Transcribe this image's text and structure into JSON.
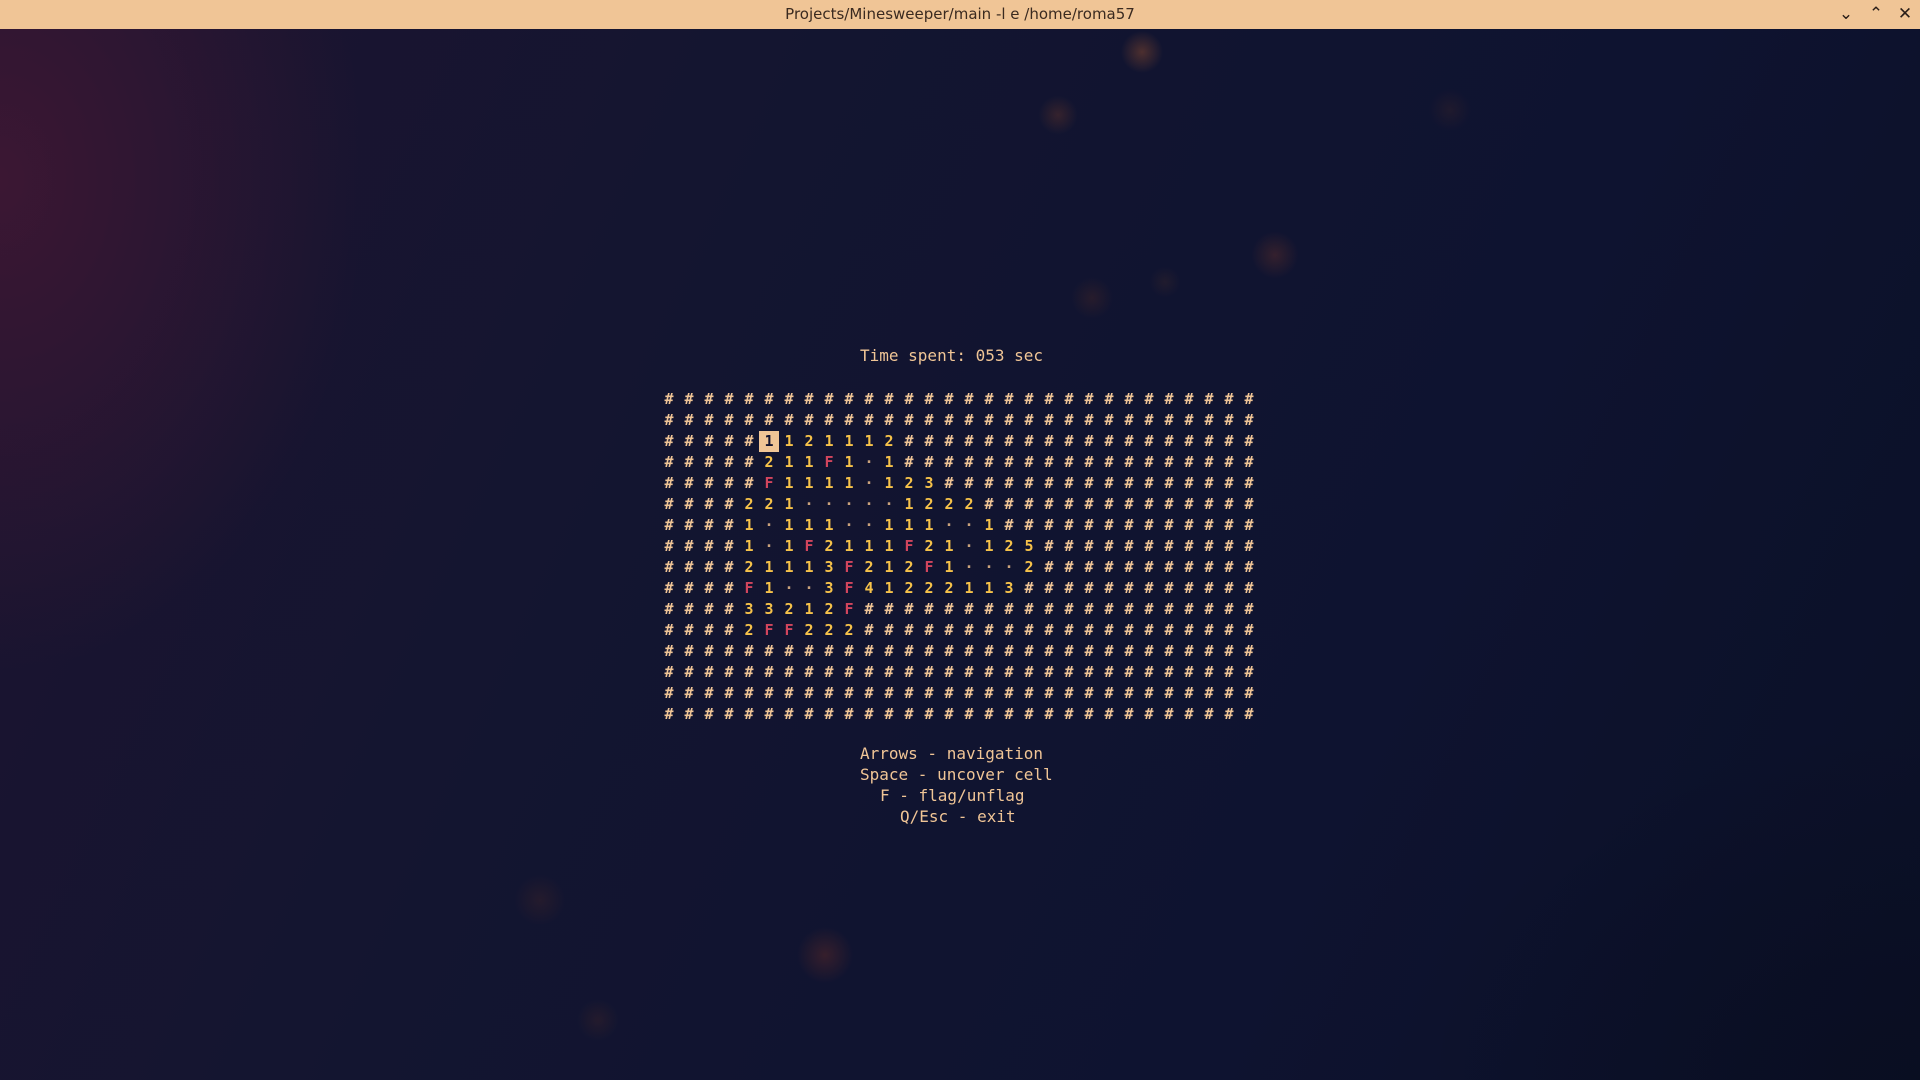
{
  "window": {
    "title": "Projects/Minesweeper/main -l e /home/roma57",
    "controls": {
      "minimize": "⌄",
      "maximize": "⌃",
      "close": "✕"
    }
  },
  "game": {
    "timer_text": "Time spent: 053 sec",
    "cursor": {
      "row": 2,
      "col": 5
    },
    "board": [
      "##############################",
      "##############################",
      "#####1121112##################",
      "#####211F1·1##################",
      "#####F1111·123################",
      "####221·····1222##############",
      "####1·111··111··1#############",
      "####1·1F2111F21·125###########",
      "####21113F212F1···2###########",
      "####F1··3F41222113############",
      "####33212F####################",
      "####2FF222####################",
      "##############################",
      "##############################",
      "##############################",
      "##############################"
    ],
    "help": [
      "Arrows - navigation",
      "Space - uncover cell",
      "F - flag/unflag",
      "Q/Esc - exit"
    ]
  },
  "colors": {
    "titlebar": "#f0c596",
    "text": "#f0c596",
    "number": "#f6c24a",
    "flag": "#d2455d"
  }
}
